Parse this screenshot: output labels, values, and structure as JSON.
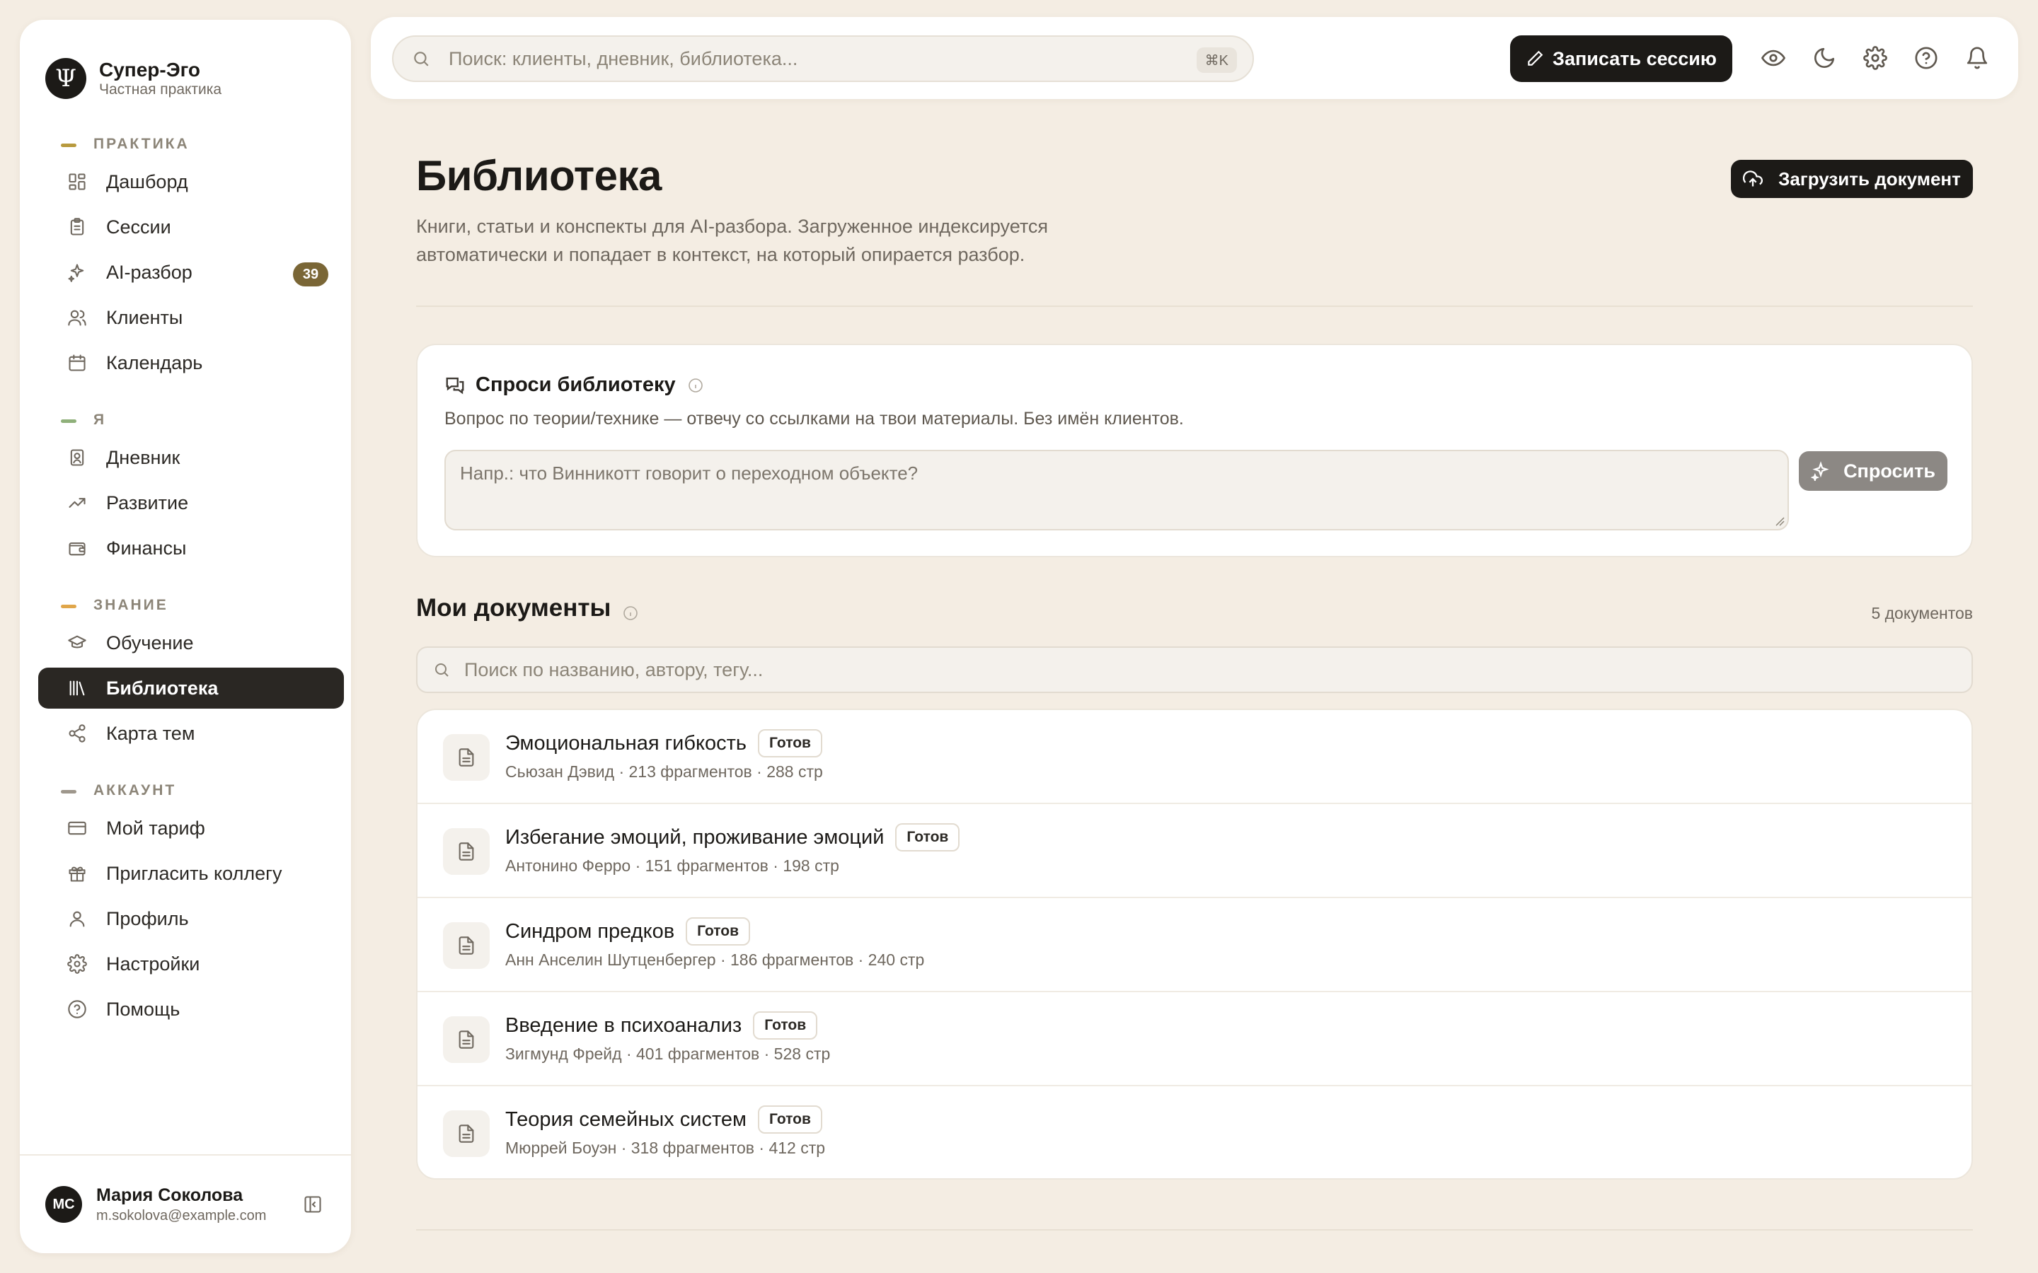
{
  "brand": {
    "name": "Супер-Эго",
    "subtitle": "Частная практика",
    "logo_glyph": "Ψ"
  },
  "sidebar": {
    "sections": [
      {
        "label": "ПРАКТИКА",
        "accent": "#b89a3e",
        "items": [
          {
            "label": "Дашборд",
            "icon": "dashboard-icon"
          },
          {
            "label": "Сессии",
            "icon": "clipboard-icon"
          },
          {
            "label": "AI-разбор",
            "icon": "sparkles-icon",
            "badge": "39"
          },
          {
            "label": "Клиенты",
            "icon": "users-icon"
          },
          {
            "label": "Календарь",
            "icon": "calendar-icon"
          }
        ]
      },
      {
        "label": "Я",
        "accent": "#8fb07a",
        "items": [
          {
            "label": "Дневник",
            "icon": "journal-icon"
          },
          {
            "label": "Развитие",
            "icon": "trending-up-icon"
          },
          {
            "label": "Финансы",
            "icon": "wallet-icon"
          }
        ]
      },
      {
        "label": "ЗНАНИЕ",
        "accent": "#e0a64a",
        "items": [
          {
            "label": "Обучение",
            "icon": "graduation-cap-icon"
          },
          {
            "label": "Библиотека",
            "icon": "library-icon",
            "active": true
          },
          {
            "label": "Карта тем",
            "icon": "share-nodes-icon"
          }
        ]
      },
      {
        "label": "АККАУНТ",
        "accent": "#9e978c",
        "items": [
          {
            "label": "Мой тариф",
            "icon": "credit-card-icon"
          },
          {
            "label": "Пригласить коллегу",
            "icon": "gift-icon"
          },
          {
            "label": "Профиль",
            "icon": "user-icon"
          },
          {
            "label": "Настройки",
            "icon": "gear-icon"
          },
          {
            "label": "Помощь",
            "icon": "help-circle-icon"
          }
        ]
      }
    ]
  },
  "user": {
    "initials": "MC",
    "name": "Мария Соколова",
    "email": "m.sokolova@example.com"
  },
  "topbar": {
    "search_placeholder": "Поиск: клиенты, дневник, библиотека...",
    "search_shortcut": "⌘K",
    "record_label": "Записать сессию",
    "icons": [
      "eye-icon",
      "moon-icon",
      "gear-icon",
      "help-circle-icon",
      "bell-icon"
    ]
  },
  "page": {
    "title": "Библиотека",
    "description": "Книги, статьи и конспекты для AI-разбора. Загруженное индексируется автоматически и попадает в контекст, на который опирается разбор.",
    "upload_label": "Загрузить документ"
  },
  "ask": {
    "title": "Спроси библиотеку",
    "subtitle": "Вопрос по теории/технике — отвечу со ссылками на твои материалы. Без имён клиентов.",
    "placeholder": "Напр.: что Винникотт говорит о переходном объекте?",
    "button_label": "Спросить"
  },
  "documents": {
    "title": "Мои документы",
    "count_label": "5 документов",
    "search_placeholder": "Поиск по названию, автору, тегу...",
    "items": [
      {
        "title": "Эмоциональная гибкость",
        "status": "Готов",
        "meta": "Сьюзан Дэвид · 213 фрагментов · 288 стр"
      },
      {
        "title": "Избегание эмоций, проживание эмоций",
        "status": "Готов",
        "meta": "Антонино Ферро · 151 фрагментов · 198 стр"
      },
      {
        "title": "Синдром предков",
        "status": "Готов",
        "meta": "Анн Анселин Шутценбергер · 186 фрагментов · 240 стр"
      },
      {
        "title": "Введение в психоанализ",
        "status": "Готов",
        "meta": "Зигмунд Фрейд · 401 фрагментов · 528 стр"
      },
      {
        "title": "Теория семейных систем",
        "status": "Готов",
        "meta": "Мюррей Боуэн · 318 фрагментов · 412 стр"
      }
    ]
  },
  "colors": {
    "background": "#f4ede3",
    "primary": "#1c1a17",
    "badge": "#7a6636",
    "ask_button": "#8c8884"
  }
}
